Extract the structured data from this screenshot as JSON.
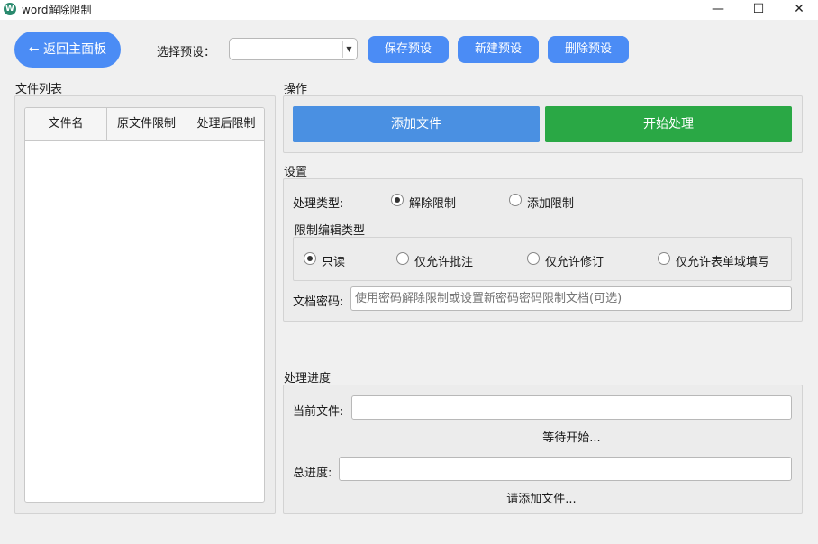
{
  "window": {
    "title": "word解除限制",
    "icon_glyph": "W",
    "controls": {
      "minimize": "—",
      "maximize": "☐",
      "close": "✕"
    }
  },
  "toolbar": {
    "back_label": "← 返回主面板",
    "preset_label": "选择预设：",
    "preset_value": "",
    "save_preset": "保存预设",
    "new_preset": "新建预设",
    "delete_preset": "删除预设"
  },
  "file_list": {
    "title": "文件列表",
    "columns": [
      "文件名",
      "原文件限制",
      "处理后限制"
    ],
    "rows": []
  },
  "operations": {
    "title": "操作",
    "add_files": "添加文件",
    "start": "开始处理"
  },
  "settings": {
    "title": "设置",
    "process_type_label": "处理类型:",
    "process_types": [
      {
        "label": "解除限制",
        "checked": true
      },
      {
        "label": "添加限制",
        "checked": false
      }
    ],
    "edit_type_title": "限制编辑类型",
    "edit_types": [
      {
        "label": "只读",
        "checked": true
      },
      {
        "label": "仅允许批注",
        "checked": false
      },
      {
        "label": "仅允许修订",
        "checked": false
      },
      {
        "label": "仅允许表单域填写",
        "checked": false
      }
    ],
    "password_label": "文档密码:",
    "password_value": "",
    "password_placeholder": "使用密码解除限制或设置新密码密码限制文档(可选)"
  },
  "progress": {
    "title": "处理进度",
    "current_file_label": "当前文件:",
    "current_progress": 0,
    "current_status": "等待开始...",
    "total_label": "总进度:",
    "total_progress": 0,
    "total_status": "请添加文件..."
  },
  "colors": {
    "accent_blue": "#4b8cf5",
    "add_button": "#4a90e2",
    "start_button": "#2aa845"
  }
}
